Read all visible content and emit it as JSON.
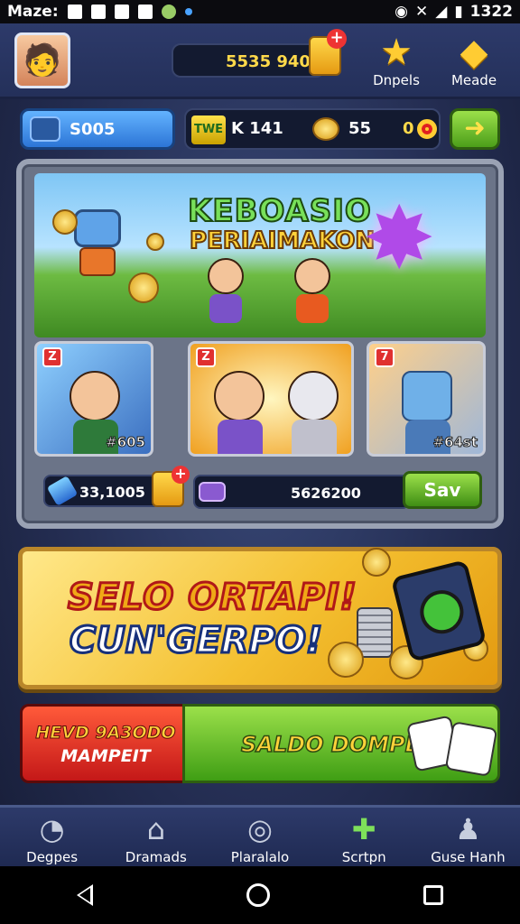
{
  "status_bar": {
    "app_label": "Maze:",
    "time": "1322"
  },
  "header": {
    "gold_amount": "5535 940",
    "icons": [
      {
        "label": "Dnpels",
        "icon": "star-icon"
      },
      {
        "label": "Meade",
        "icon": "gem-icon"
      }
    ]
  },
  "row2": {
    "blue_value": "S005",
    "badge_text": "TWE",
    "counter_label": "K 141",
    "coins_value": "55",
    "zero_value": "0"
  },
  "banner": {
    "title_line1": "KEBOASIO",
    "title_line2": "PERIAIMAKON"
  },
  "cards": [
    {
      "level": "Z",
      "price": "#605"
    },
    {
      "level": "Z",
      "price": ""
    },
    {
      "level": "7",
      "price": "#64st"
    }
  ],
  "panel_bottom": {
    "gem_value": "33,1005",
    "input_value": "5626200",
    "save_label": "Sav"
  },
  "promo": {
    "line1": "SELO ORTAPI!",
    "line2": "CUN'GERPO!"
  },
  "action": {
    "red_line1": "HEVD 9A3ODO",
    "red_line2": "MAMPEIT",
    "green_label": "SALDO DOMPET"
  },
  "nav": [
    {
      "label": "Degpes",
      "icon": "cat-icon"
    },
    {
      "label": "Dramads",
      "icon": "house-icon"
    },
    {
      "label": "Plaralalo",
      "icon": "disc-icon"
    },
    {
      "label": "Scrtpn",
      "icon": "wrench-icon"
    },
    {
      "label": "Guse Hanh",
      "icon": "joystick-icon"
    }
  ],
  "colors": {
    "gold": "#ffd94a",
    "green": "#4c9e1a",
    "red": "#c41818",
    "blue": "#2c75d6"
  }
}
